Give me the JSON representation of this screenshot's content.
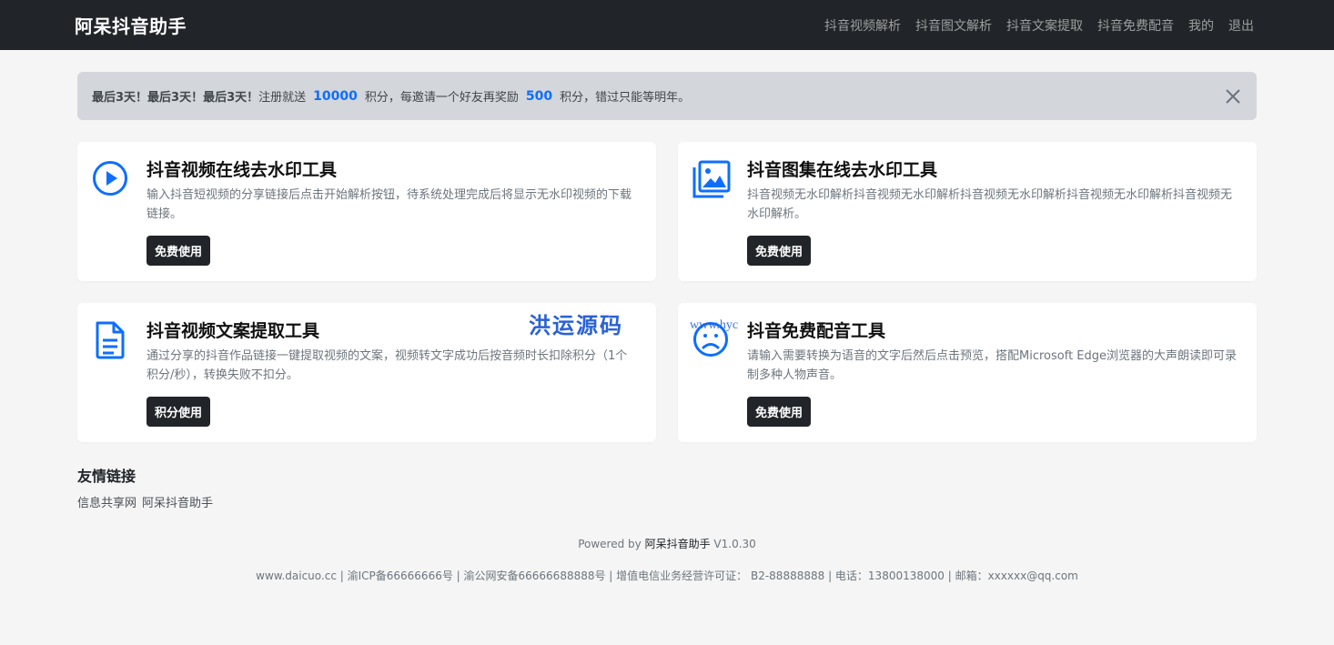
{
  "navbar": {
    "brand": "阿呆抖音助手",
    "links": [
      "抖音视频解析",
      "抖音图文解析",
      "抖音文案提取",
      "抖音免费配音",
      "我的",
      "退出"
    ]
  },
  "alert": {
    "lead": "最后3天！最后3天！最后3天！",
    "text1": "注册就送",
    "num1": "10000",
    "text2": "积分，每邀请一个好友再奖励",
    "num2": "500",
    "text3": "积分，错过只能等明年。",
    "close_icon": "close-icon"
  },
  "cards": [
    {
      "icon": "play-circle-icon",
      "title": "抖音视频在线去水印工具",
      "text": "输入抖音短视频的分享链接后点击开始解析按钮，待系统处理完成后将显示无水印视频的下载链接。",
      "button": "免费使用"
    },
    {
      "icon": "images-icon",
      "title": "抖音图集在线去水印工具",
      "text": "抖音视频无水印解析抖音视频无水印解析抖音视频无水印解析抖音视频无水印解析抖音视频无水印解析。",
      "button": "免费使用"
    },
    {
      "icon": "file-text-icon",
      "title": "抖音视频文案提取工具",
      "text": "通过分享的抖音作品链接一键提取视频的文案，视频转文字成功后按音频时长扣除积分（1个积分/秒），转换失败不扣分。",
      "button": "积分使用"
    },
    {
      "icon": "frown-face-icon",
      "title": "抖音免费配音工具",
      "text": "请输入需要转换为语音的文字后然后点击预览，搭配Microsoft Edge浏览器的大声朗读即可录制多种人物声音。",
      "button": "免费使用"
    }
  ],
  "friend_links": {
    "title": "友情链接",
    "items": [
      "信息共享网",
      "阿呆抖音助手"
    ]
  },
  "footer": {
    "powered_prefix": "Powered by",
    "powered_name": "阿呆抖音助手",
    "version": "V1.0.30",
    "info": "www.daicuo.cc | 渝ICP备66666666号 | 渝公网安备66666688888号 | 增值电信业务经营许可证： B2-88888888 | 电话：13800138000 | 邮箱：xxxxxx@qq.com"
  },
  "watermark": {
    "text": "洪运源码",
    "url": "www.hyc"
  },
  "colors": {
    "accent": "#0d6efd",
    "navbar_bg": "#212529",
    "alert_bg": "#d3d6db",
    "page_bg": "#f5f5f5"
  }
}
